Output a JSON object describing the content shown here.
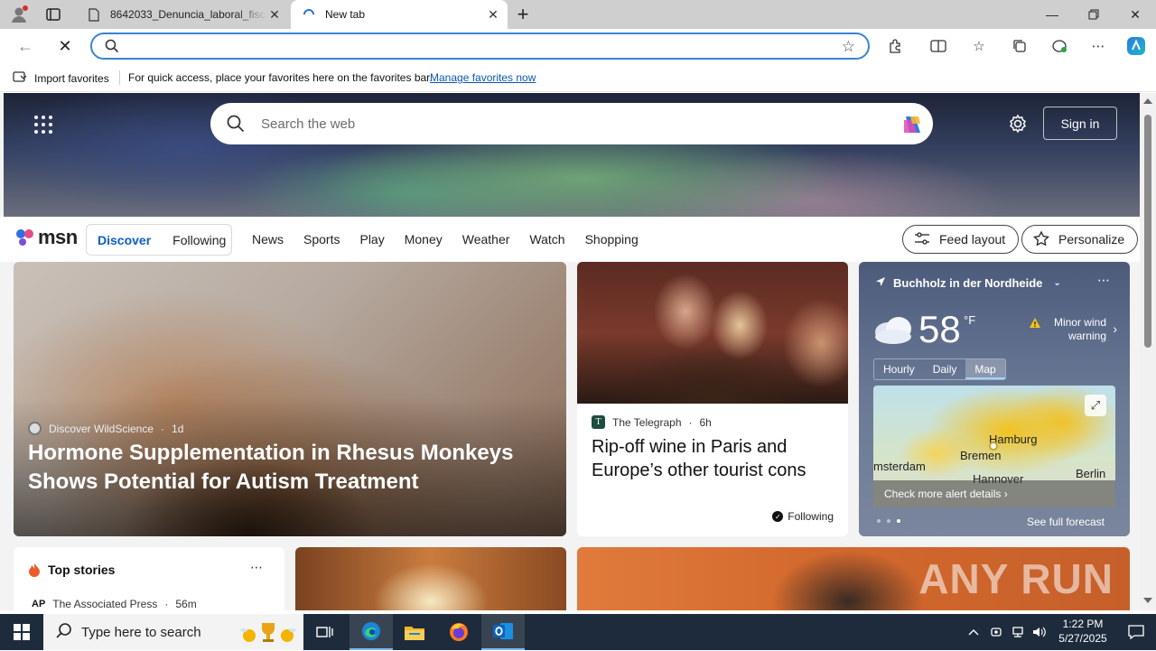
{
  "browser": {
    "tabs": [
      {
        "title": "8642033_Denuncia_laboral_fiscal...",
        "active": false
      },
      {
        "title": "New tab",
        "active": true
      }
    ],
    "address_value": "",
    "favorites_bar": {
      "import_label": "Import favorites",
      "message": "For quick access, place your favorites here on the favorites bar.",
      "manage_link": "Manage favorites now"
    }
  },
  "msn": {
    "search_placeholder": "Search the web",
    "sign_in": "Sign in",
    "logo_text": "msn",
    "feed_pills": [
      {
        "label": "Discover",
        "active": true
      },
      {
        "label": "Following",
        "active": false
      }
    ],
    "nav_links": [
      "News",
      "Sports",
      "Play",
      "Money",
      "Weather",
      "Watch",
      "Shopping"
    ],
    "feed_layout": "Feed layout",
    "personalize": "Personalize",
    "lead_story": {
      "source": "Discover WildScience",
      "age": "1d",
      "headline": "Hormone Supplementation in Rhesus Monkeys Shows Potential for Autism Treatment"
    },
    "secondary_story": {
      "source": "The Telegraph",
      "age": "6h",
      "headline": "Rip-off wine in Paris and Europe’s other tourist cons",
      "following": "Following"
    },
    "weather": {
      "location": "Buchholz in der Nordheide",
      "temperature": "58",
      "unit": "°F",
      "warning": "Minor wind warning",
      "tabs": [
        {
          "label": "Hourly",
          "active": false
        },
        {
          "label": "Daily",
          "active": false
        },
        {
          "label": "Map",
          "active": true
        }
      ],
      "map_labels": [
        "Hamburg",
        "Bremen",
        "Hannover",
        "Berlin",
        "msterdam"
      ],
      "alert_link": "Check more alert details",
      "forecast_link": "See full forecast"
    },
    "top_stories": {
      "title": "Top stories",
      "source": "The Associated Press",
      "source_abbr": "AP",
      "age": "56m"
    },
    "watermark": "ANY RUN"
  },
  "taskbar": {
    "search_placeholder": "Type here to search",
    "time": "1:22 PM",
    "date": "5/27/2025"
  }
}
